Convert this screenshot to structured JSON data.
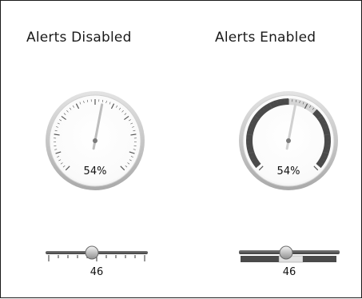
{
  "panels": [
    {
      "title": "Alerts Disabled",
      "alerts_enabled": false,
      "gauge": {
        "value_label": "54%",
        "value_percent": 54
      },
      "slider": {
        "value_label": "46",
        "value": 46
      }
    },
    {
      "title": "Alerts Enabled",
      "alerts_enabled": true,
      "gauge": {
        "value_label": "54%",
        "value_percent": 54
      },
      "slider": {
        "value_label": "46",
        "value": 46
      }
    }
  ],
  "colors": {
    "alert_band": "#4a4a4a",
    "alert_band_light": "#d6d6d6",
    "needle": "#c8c8c8",
    "gauge_rim": "#cfcfcf",
    "gauge_face": "#ffffff"
  }
}
